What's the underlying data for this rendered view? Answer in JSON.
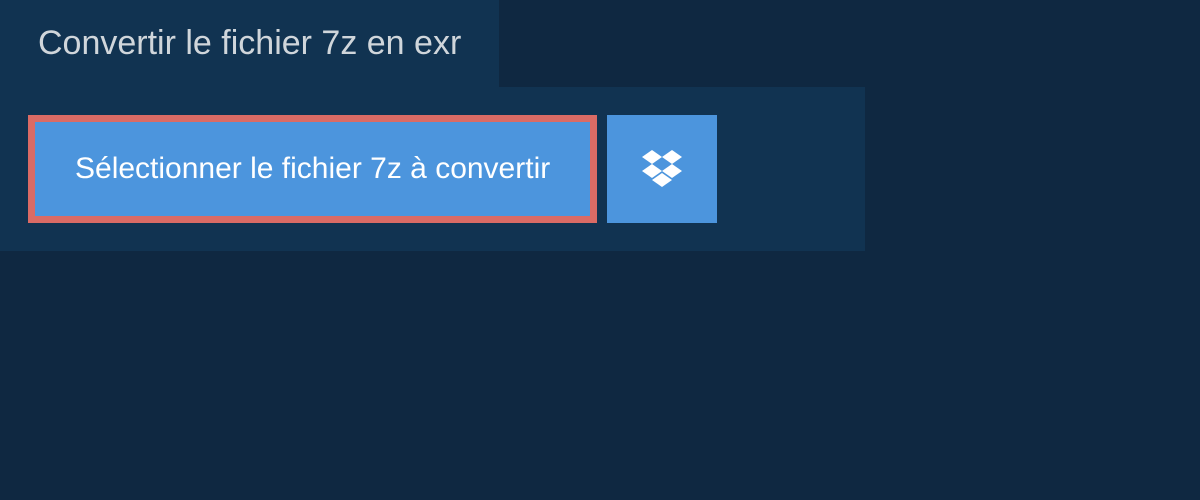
{
  "tab": {
    "label": "Convertir le fichier 7z en exr"
  },
  "buttons": {
    "select_file_label": "Sélectionner le fichier 7z à convertir"
  },
  "colors": {
    "background": "#0f2841",
    "panel": "#113351",
    "button_primary": "#4c95dd",
    "highlight_border": "#da6b65",
    "text_light": "#d0d6db",
    "text_white": "#ffffff"
  }
}
